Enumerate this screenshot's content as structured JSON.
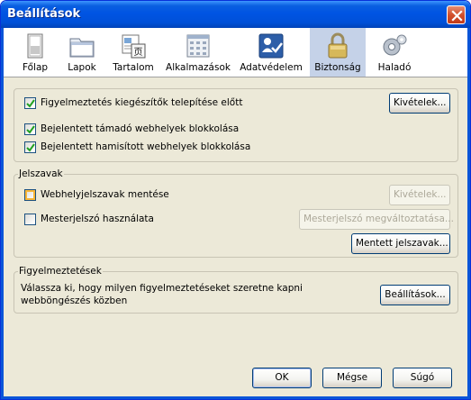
{
  "window": {
    "title": "Beállítások"
  },
  "tabs": [
    {
      "label": "Főlap",
      "icon": "main-icon"
    },
    {
      "label": "Lapok",
      "icon": "tabs-icon"
    },
    {
      "label": "Tartalom",
      "icon": "content-icon"
    },
    {
      "label": "Alkalmazások",
      "icon": "applications-icon"
    },
    {
      "label": "Adatvédelem",
      "icon": "privacy-icon"
    },
    {
      "label": "Biztonság",
      "icon": "security-lock-icon",
      "selected": true
    },
    {
      "label": "Haladó",
      "icon": "advanced-gear-icon"
    }
  ],
  "security": {
    "warn_addons": {
      "label": "Figyelmeztetés kiegészítők telepítése előtt",
      "checked": true
    },
    "exceptions_button": "Kivételek...",
    "block_attack": {
      "label": "Bejelentett támadó webhelyek blokkolása",
      "checked": true
    },
    "block_forgery": {
      "label": "Bejelentett hamisított webhelyek blokkolása",
      "checked": true
    }
  },
  "passwords": {
    "legend": "Jelszavak",
    "remember": {
      "label": "Webhelyjelszavak mentése",
      "checked": false
    },
    "exceptions_button": "Kivételek...",
    "master": {
      "label": "Mesterjelszó használata",
      "checked": false
    },
    "change_master_button": "Mesterjelszó megváltoztatása...",
    "saved_button": "Mentett jelszavak..."
  },
  "warnings": {
    "legend": "Figyelmeztetések",
    "text": "Válassza ki, hogy milyen figyelmeztetéseket szeretne kapni webböngészés közben",
    "settings_button": "Beállítások..."
  },
  "footer": {
    "ok": "OK",
    "cancel": "Mégse",
    "help": "Súgó"
  },
  "colors": {
    "titlebar": "#0054e3",
    "dialog_bg": "#ece9d8",
    "selected_tab": "#c5d2e8",
    "button_border": "#003c74",
    "checkbox_border": "#1c5180"
  }
}
